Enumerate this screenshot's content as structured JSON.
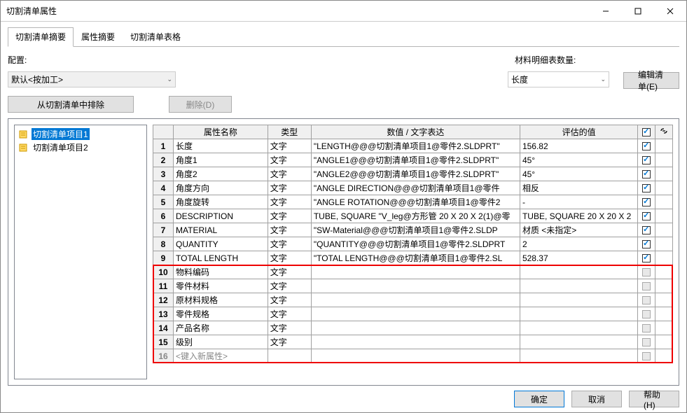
{
  "window": {
    "title": "切割清单属性"
  },
  "tabs": [
    "切割清单摘要",
    "属性摘要",
    "切割清单表格"
  ],
  "activeTab": 0,
  "config": {
    "leftLabel": "配置:",
    "leftValue": "默认<按加工>",
    "rightLabel": "材料明细表数量:",
    "rightValue": "长度",
    "editBtn": "编辑清单(E)"
  },
  "buttons": {
    "exclude": "从切割清单中排除",
    "delete": "删除(D)"
  },
  "tree": {
    "items": [
      {
        "label": "切割清单项目1",
        "selected": true
      },
      {
        "label": "切割清单项目2",
        "selected": false
      }
    ]
  },
  "table": {
    "headers": {
      "name": "属性名称",
      "type": "类型",
      "expr": "数值 / 文字表达",
      "eval": "评估的值",
      "check": "☑",
      "link": "⟲"
    },
    "rows": [
      {
        "n": "1",
        "name": "长度",
        "type": "文字",
        "expr": "\"LENGTH@@@切割清单项目1@零件2.SLDPRT\"",
        "eval": "156.82",
        "chk": true
      },
      {
        "n": "2",
        "name": "角度1",
        "type": "文字",
        "expr": "\"ANGLE1@@@切割清单项目1@零件2.SLDPRT\"",
        "eval": "45°",
        "chk": true
      },
      {
        "n": "3",
        "name": "角度2",
        "type": "文字",
        "expr": "\"ANGLE2@@@切割清单项目1@零件2.SLDPRT\"",
        "eval": "45°",
        "chk": true
      },
      {
        "n": "4",
        "name": "角度方向",
        "type": "文字",
        "expr": "\"ANGLE DIRECTION@@@切割清单项目1@零件",
        "eval": "相反",
        "chk": true
      },
      {
        "n": "5",
        "name": "角度旋转",
        "type": "文字",
        "expr": "\"ANGLE ROTATION@@@切割清单项目1@零件2",
        "eval": "-",
        "chk": true
      },
      {
        "n": "6",
        "name": "DESCRIPTION",
        "type": "文字",
        "expr": "TUBE, SQUARE \"V_leg@方形管 20 X 20 X 2(1)@零",
        "eval": "TUBE, SQUARE 20 X 20 X 2",
        "chk": true
      },
      {
        "n": "7",
        "name": "MATERIAL",
        "type": "文字",
        "expr": "\"SW-Material@@@切割清单项目1@零件2.SLDP",
        "eval": "材质 <未指定>",
        "chk": true
      },
      {
        "n": "8",
        "name": "QUANTITY",
        "type": "文字",
        "expr": "\"QUANTITY@@@切割清单项目1@零件2.SLDPRT",
        "eval": "2",
        "chk": true
      },
      {
        "n": "9",
        "name": "TOTAL LENGTH",
        "type": "文字",
        "expr": "\"TOTAL LENGTH@@@切割清单项目1@零件2.SL",
        "eval": "528.37",
        "chk": true
      },
      {
        "n": "10",
        "name": "物料编码",
        "type": "文字",
        "expr": "",
        "eval": "",
        "chk": false,
        "dis": true
      },
      {
        "n": "11",
        "name": "零件材料",
        "type": "文字",
        "expr": "",
        "eval": "",
        "chk": false,
        "dis": true
      },
      {
        "n": "12",
        "name": "原材料规格",
        "type": "文字",
        "expr": "",
        "eval": "",
        "chk": false,
        "dis": true
      },
      {
        "n": "13",
        "name": "零件规格",
        "type": "文字",
        "expr": "",
        "eval": "",
        "chk": false,
        "dis": true
      },
      {
        "n": "14",
        "name": "产品名称",
        "type": "文字",
        "expr": "",
        "eval": "",
        "chk": false,
        "dis": true
      },
      {
        "n": "15",
        "name": "级别",
        "type": "文字",
        "expr": "",
        "eval": "",
        "chk": false,
        "dis": true
      },
      {
        "n": "16",
        "name": "<键入新属性>",
        "type": "",
        "expr": "",
        "eval": "",
        "chk": false,
        "dis": true,
        "placeholder": true
      }
    ]
  },
  "footer": {
    "ok": "确定",
    "cancel": "取消",
    "help": "帮助(H)"
  }
}
